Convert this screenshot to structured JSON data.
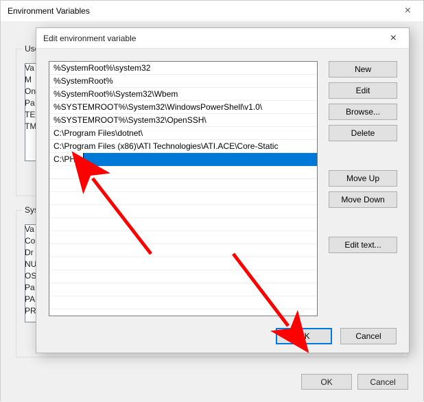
{
  "back": {
    "title": "Environment Variables",
    "user_group": "User",
    "system_group": "Syste",
    "ok": "OK",
    "cancel": "Cancel",
    "user_rows": [
      "Va",
      "M",
      "On",
      "Pa",
      "TE",
      "TM"
    ],
    "sys_rows": [
      "Va",
      "Co",
      "Dr",
      "NU",
      "OS",
      "Pa",
      "PA",
      "PR"
    ]
  },
  "front": {
    "title": "Edit environment variable",
    "close": "×",
    "entries": [
      "%SystemRoot%\\system32",
      "%SystemRoot%",
      "%SystemRoot%\\System32\\Wbem",
      "%SYSTEMROOT%\\System32\\WindowsPowerShell\\v1.0\\",
      "%SYSTEMROOT%\\System32\\OpenSSH\\",
      "C:\\Program Files\\dotnet\\",
      "C:\\Program Files (x86)\\ATI Technologies\\ATI.ACE\\Core-Static"
    ],
    "editing_value": "C:\\PHP",
    "buttons": {
      "new": "New",
      "edit": "Edit",
      "browse": "Browse...",
      "delete": "Delete",
      "move_up": "Move Up",
      "move_down": "Move Down",
      "edit_text": "Edit text...",
      "ok": "OK",
      "cancel": "Cancel"
    }
  },
  "colors": {
    "selection": "#0078d7",
    "arrow": "#ff0000"
  }
}
